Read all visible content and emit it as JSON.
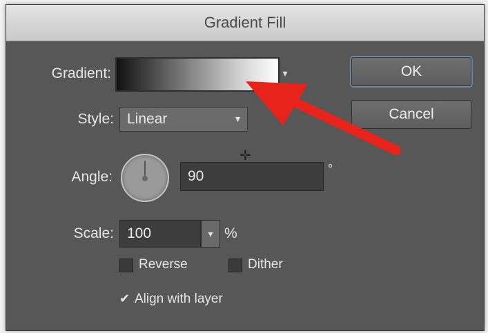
{
  "dialog": {
    "title": "Gradient Fill",
    "gradient_label": "Gradient:",
    "style_label": "Style:",
    "style_value": "Linear",
    "angle_label": "Angle:",
    "angle_value": "90",
    "angle_unit": "°",
    "scale_label": "Scale:",
    "scale_value": "100",
    "scale_unit": "%",
    "reverse_label": "Reverse",
    "reverse_checked": false,
    "dither_label": "Dither",
    "dither_checked": false,
    "align_label": "Align with layer",
    "align_checked": true,
    "ok_label": "OK",
    "cancel_label": "Cancel"
  },
  "colors": {
    "dialog_bg": "#575757",
    "annotation_arrow": "#e8231b"
  },
  "icons": {
    "gradient_dropdown": "chevron-down-icon",
    "style_dropdown": "chevron-down-icon",
    "angle_dial": "angle-dial-icon",
    "scale_stepper": "chevron-down-icon",
    "annotation": "red-arrow-annotation-icon"
  }
}
